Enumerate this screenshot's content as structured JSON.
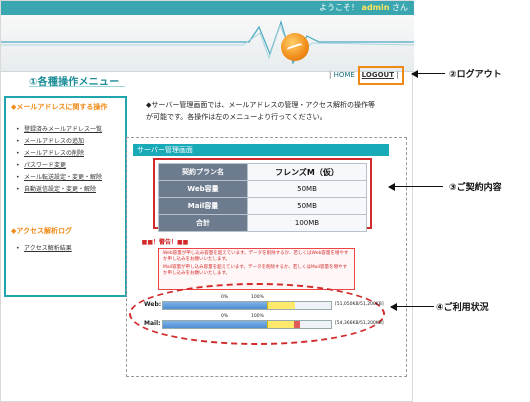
{
  "topbar": {
    "welcome_prefix": "ようこそ！",
    "user": "admin",
    "suffix": "さん"
  },
  "menu_title": {
    "num": "①",
    "label": "各種操作メニュー"
  },
  "links": {
    "home": "HOME",
    "logout": "LOGOUT",
    "sep": "|"
  },
  "sidebar": {
    "mail_head": "◆メールアドレスに関する操作",
    "mail_items": [
      "登録済みメールアドレス一覧",
      "メールアドレスの追加",
      "メールアドレスの削除",
      "パスワード変更",
      "メール転送設定・変更・解除",
      "自動返信設定・変更・解除"
    ],
    "log_head": "◆アクセス解析ログ",
    "log_items": [
      "アクセス解析結果"
    ]
  },
  "intro": "◆サーバー管理画面では、メールアドレスの管理・アクセス解析の操作等が可能です。各操作は左のメニューより行ってください。",
  "panel_title": "サーバー管理画面",
  "contract": [
    {
      "label": "契約プラン名",
      "value": "フレンズM（仮）"
    },
    {
      "label": "Web容量",
      "value": "50MB"
    },
    {
      "label": "Mail容量",
      "value": "50MB"
    },
    {
      "label": "合計",
      "value": "100MB"
    }
  ],
  "warning": {
    "title": "■■！警告！■■",
    "web": "Web容量が申し込み容量を超えています。データを削除するか、若しくはWeb容量を増やすか申し込みをお願いいたします。",
    "mail": "Mail容量が申し込み容量を超えています。データを削除するか、若しくはMail容量を増やすか申し込みをお願いいたします。"
  },
  "usage": [
    {
      "label": "Web:",
      "p0": "0%",
      "p100": "100%",
      "capacity": "[51,050KB/51,200KB]",
      "fill_fraction": 0.997
    },
    {
      "label": "Mail:",
      "p0": "0%",
      "p100": "100%",
      "capacity": "[54,366KB/51,200KB]",
      "fill_fraction": 1.06
    }
  ],
  "callouts": {
    "logout": "②ログアウト",
    "contract": "③ご契約内容",
    "usage": "④ご利用状況"
  },
  "colors": {
    "accent": "#20a5ad",
    "callout_box": "#f08a17",
    "alert": "#d22a2a"
  }
}
